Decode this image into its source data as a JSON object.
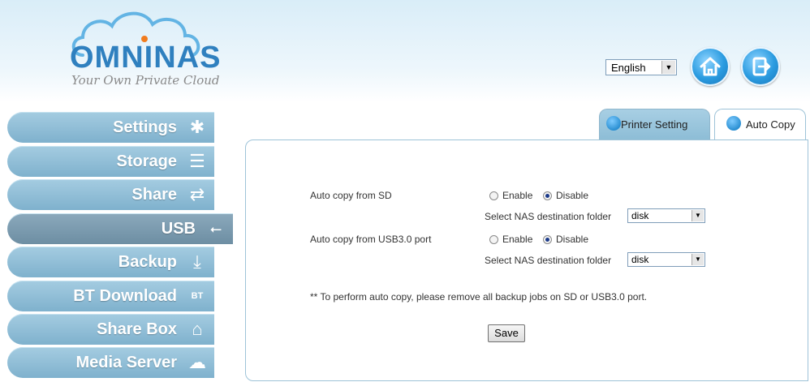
{
  "header": {
    "logo_text": "OMNINAS",
    "logo_tagline": "Your Own Private Cloud",
    "language": {
      "selected": "English"
    },
    "home_icon": "home-icon",
    "logout_icon": "logout-icon"
  },
  "sidebar": {
    "items": [
      {
        "label": "Settings",
        "icon": "tools-icon"
      },
      {
        "label": "Storage",
        "icon": "storage-icon"
      },
      {
        "label": "Share",
        "icon": "share-arrows-icon"
      },
      {
        "label": "USB",
        "icon": "usb-icon",
        "active": true
      },
      {
        "label": "Backup",
        "icon": "backup-icon"
      },
      {
        "label": "BT Download",
        "icon": "bt-icon"
      },
      {
        "label": "Share Box",
        "icon": "share-box-icon"
      },
      {
        "label": "Media Server",
        "icon": "media-server-icon"
      }
    ]
  },
  "tabs": [
    {
      "label": "Printer Setting",
      "icon": "printer-icon"
    },
    {
      "label": "Auto Copy",
      "icon": "auto-copy-icon",
      "active": true
    }
  ],
  "form": {
    "sd": {
      "label": "Auto copy from SD",
      "enable_label": "Enable",
      "disable_label": "Disable",
      "selected": "Disable",
      "folder_label": "Select NAS destination folder",
      "folder_value": "disk"
    },
    "usb": {
      "label": "Auto copy from USB3.0 port",
      "enable_label": "Enable",
      "disable_label": "Disable",
      "selected": "Disable",
      "folder_label": "Select NAS destination folder",
      "folder_value": "disk"
    },
    "note": "** To perform auto copy, please remove all backup jobs on SD or USB3.0 port.",
    "save_label": "Save"
  },
  "colors": {
    "sidebar": "#8fbfd8",
    "sidebar_active": "#7d9db2",
    "brand_blue": "#2f80bf"
  }
}
